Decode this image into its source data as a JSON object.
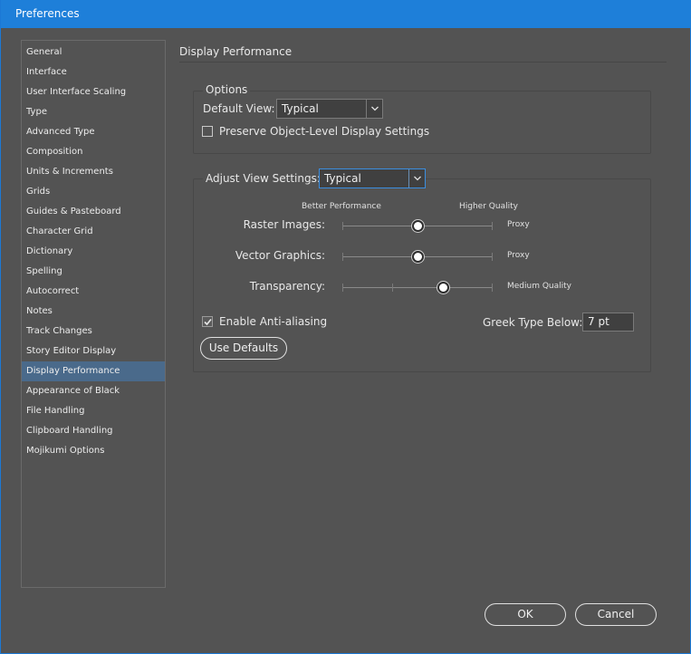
{
  "window": {
    "title": "Preferences"
  },
  "sidebar": {
    "items": [
      {
        "label": "General"
      },
      {
        "label": "Interface"
      },
      {
        "label": "User Interface Scaling"
      },
      {
        "label": "Type"
      },
      {
        "label": "Advanced Type"
      },
      {
        "label": "Composition"
      },
      {
        "label": "Units & Increments"
      },
      {
        "label": "Grids"
      },
      {
        "label": "Guides & Pasteboard"
      },
      {
        "label": "Character Grid"
      },
      {
        "label": "Dictionary"
      },
      {
        "label": "Spelling"
      },
      {
        "label": "Autocorrect"
      },
      {
        "label": "Notes"
      },
      {
        "label": "Track Changes"
      },
      {
        "label": "Story Editor Display"
      },
      {
        "label": "Display Performance"
      },
      {
        "label": "Appearance of Black"
      },
      {
        "label": "File Handling"
      },
      {
        "label": "Clipboard Handling"
      },
      {
        "label": "Mojikumi Options"
      }
    ],
    "selected_index": 16
  },
  "main": {
    "section_title": "Display Performance",
    "options": {
      "group_label": "Options",
      "default_view_label": "Default View:",
      "default_view_value": "Typical",
      "preserve_label": "Preserve Object-Level Display Settings",
      "preserve_checked": false
    },
    "adjust": {
      "label": "Adjust View Settings:",
      "value": "Typical",
      "better_performance": "Better Performance",
      "higher_quality": "Higher Quality",
      "sliders": [
        {
          "label": "Raster Images:",
          "value_text": "Proxy",
          "level": 0.5,
          "ticks": false
        },
        {
          "label": "Vector Graphics:",
          "value_text": "Proxy",
          "level": 0.5,
          "ticks": false
        },
        {
          "label": "Transparency:",
          "value_text": "Medium Quality",
          "level": 0.67,
          "ticks": true
        }
      ],
      "antialiasing_label": "Enable Anti-aliasing",
      "antialiasing_checked": true,
      "greek_label": "Greek Type Below:",
      "greek_value": "7 pt",
      "use_defaults_label": "Use Defaults"
    }
  },
  "footer": {
    "ok_label": "OK",
    "cancel_label": "Cancel"
  }
}
